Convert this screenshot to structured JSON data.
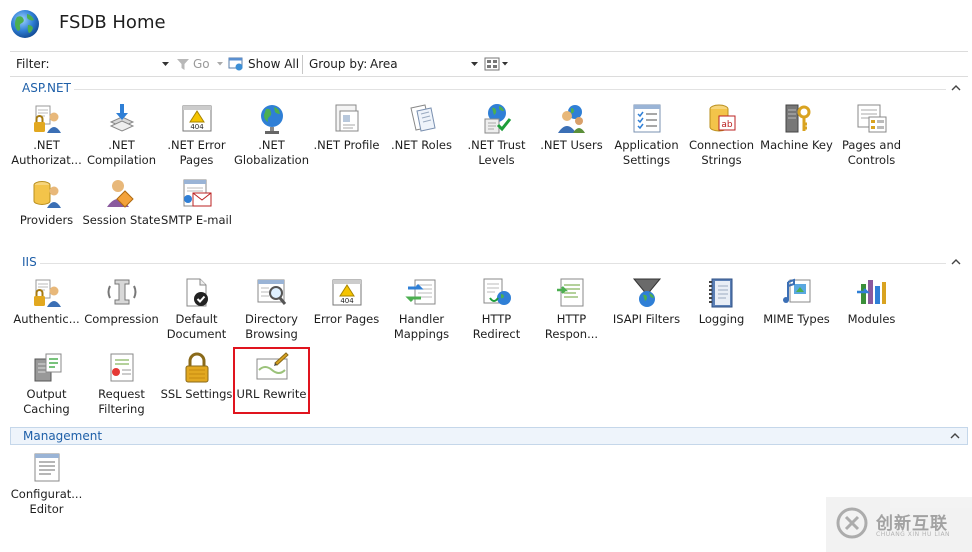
{
  "header": {
    "title": "FSDB Home"
  },
  "toolbar": {
    "filter_label": "Filter:",
    "go_label": "Go",
    "show_all_label": "Show All",
    "group_by_label": "Group by:",
    "group_by_value": "Area"
  },
  "groups": {
    "aspnet": {
      "name": "ASP.NET"
    },
    "iis": {
      "name": "IIS"
    },
    "management": {
      "name": "Management"
    }
  },
  "aspnet_items": [
    {
      "label": ".NET\nAuthorizat...",
      "icon": "lock-user-icon"
    },
    {
      "label": ".NET\nCompilation",
      "icon": "compile-arrow-icon"
    },
    {
      "label": ".NET Error\nPages",
      "icon": "warning-404-icon"
    },
    {
      "label": ".NET\nGlobalization",
      "icon": "globe-icon"
    },
    {
      "label": ".NET Profile",
      "icon": "profile-window-icon"
    },
    {
      "label": ".NET Roles",
      "icon": "roles-doc-icon"
    },
    {
      "label": ".NET Trust\nLevels",
      "icon": "globe-check-icon"
    },
    {
      "label": ".NET Users",
      "icon": "users-globe-icon"
    },
    {
      "label": "Application\nSettings",
      "icon": "checklist-icon"
    },
    {
      "label": "Connection\nStrings",
      "icon": "database-ab-icon"
    },
    {
      "label": "Machine Key",
      "icon": "server-key-icon"
    },
    {
      "label": "Pages and\nControls",
      "icon": "pages-controls-icon"
    },
    {
      "label": "Providers",
      "icon": "providers-db-icon"
    },
    {
      "label": "Session State",
      "icon": "session-user-icon"
    },
    {
      "label": "SMTP E-mail",
      "icon": "email-window-icon"
    }
  ],
  "iis_items": [
    {
      "label": "Authentic...",
      "icon": "lock-user-icon"
    },
    {
      "label": "Compression",
      "icon": "clamp-icon"
    },
    {
      "label": "Default\nDocument",
      "icon": "document-check-icon"
    },
    {
      "label": "Directory\nBrowsing",
      "icon": "magnifier-window-icon"
    },
    {
      "label": "Error Pages",
      "icon": "warning-404-icon"
    },
    {
      "label": "Handler\nMappings",
      "icon": "handler-arrows-icon"
    },
    {
      "label": "HTTP\nRedirect",
      "icon": "redirect-globe-icon"
    },
    {
      "label": "HTTP\nRespon...",
      "icon": "http-response-icon"
    },
    {
      "label": "ISAPI Filters",
      "icon": "funnel-globe-icon"
    },
    {
      "label": "Logging",
      "icon": "notebook-icon"
    },
    {
      "label": "MIME Types",
      "icon": "mime-music-icon"
    },
    {
      "label": "Modules",
      "icon": "modules-icon"
    },
    {
      "label": "Output\nCaching",
      "icon": "output-cache-icon"
    },
    {
      "label": "Request\nFiltering",
      "icon": "request-filter-icon"
    },
    {
      "label": "SSL Settings",
      "icon": "padlock-icon"
    },
    {
      "label": "URL Rewrite",
      "icon": "url-rewrite-icon"
    }
  ],
  "management_items": [
    {
      "label": "Configurat...\nEditor",
      "icon": "config-editor-icon"
    }
  ],
  "watermark": {
    "text": "创新互联",
    "sub": "CHUANG XIN HU LIAN"
  },
  "colors": {
    "group_header": "#1e5fa8",
    "highlight": "#e0141e",
    "selected_group_bg": "#eef4fb"
  }
}
